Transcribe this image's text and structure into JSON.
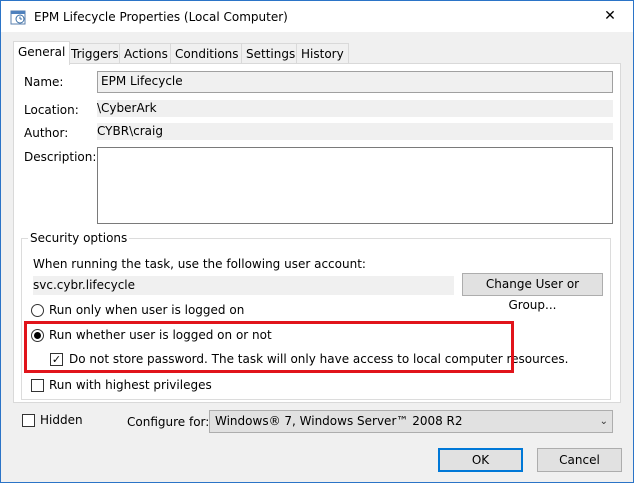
{
  "window": {
    "title": "EPM Lifecycle Properties (Local Computer)",
    "close_glyph": "✕"
  },
  "tabs": [
    {
      "label": "General",
      "active": true
    },
    {
      "label": "Triggers"
    },
    {
      "label": "Actions"
    },
    {
      "label": "Conditions"
    },
    {
      "label": "Settings"
    },
    {
      "label": "History"
    }
  ],
  "general": {
    "name_label": "Name:",
    "name_value": "EPM Lifecycle",
    "location_label": "Location:",
    "location_value": "\\CyberArk",
    "author_label": "Author:",
    "author_value": "CYBR\\craig",
    "description_label": "Description:",
    "description_value": ""
  },
  "security": {
    "title": "Security options",
    "account_prompt": "When running the task, use the following user account:",
    "account_value": "svc.cybr.lifecycle",
    "change_button": "Change User or Group...",
    "radio_logged_on": "Run only when user is logged on",
    "radio_whether": "Run whether user is logged on or not",
    "do_not_store": "Do not store password.  The task will only have access to local computer resources.",
    "highest_privileges": "Run with highest privileges"
  },
  "bottom": {
    "hidden_label": "Hidden",
    "configure_label": "Configure for:",
    "configure_value": "Windows® 7, Windows Server™ 2008 R2"
  },
  "buttons": {
    "ok": "OK",
    "cancel": "Cancel"
  },
  "colors": {
    "highlight": "#e1141b",
    "accent": "#0078d7"
  }
}
